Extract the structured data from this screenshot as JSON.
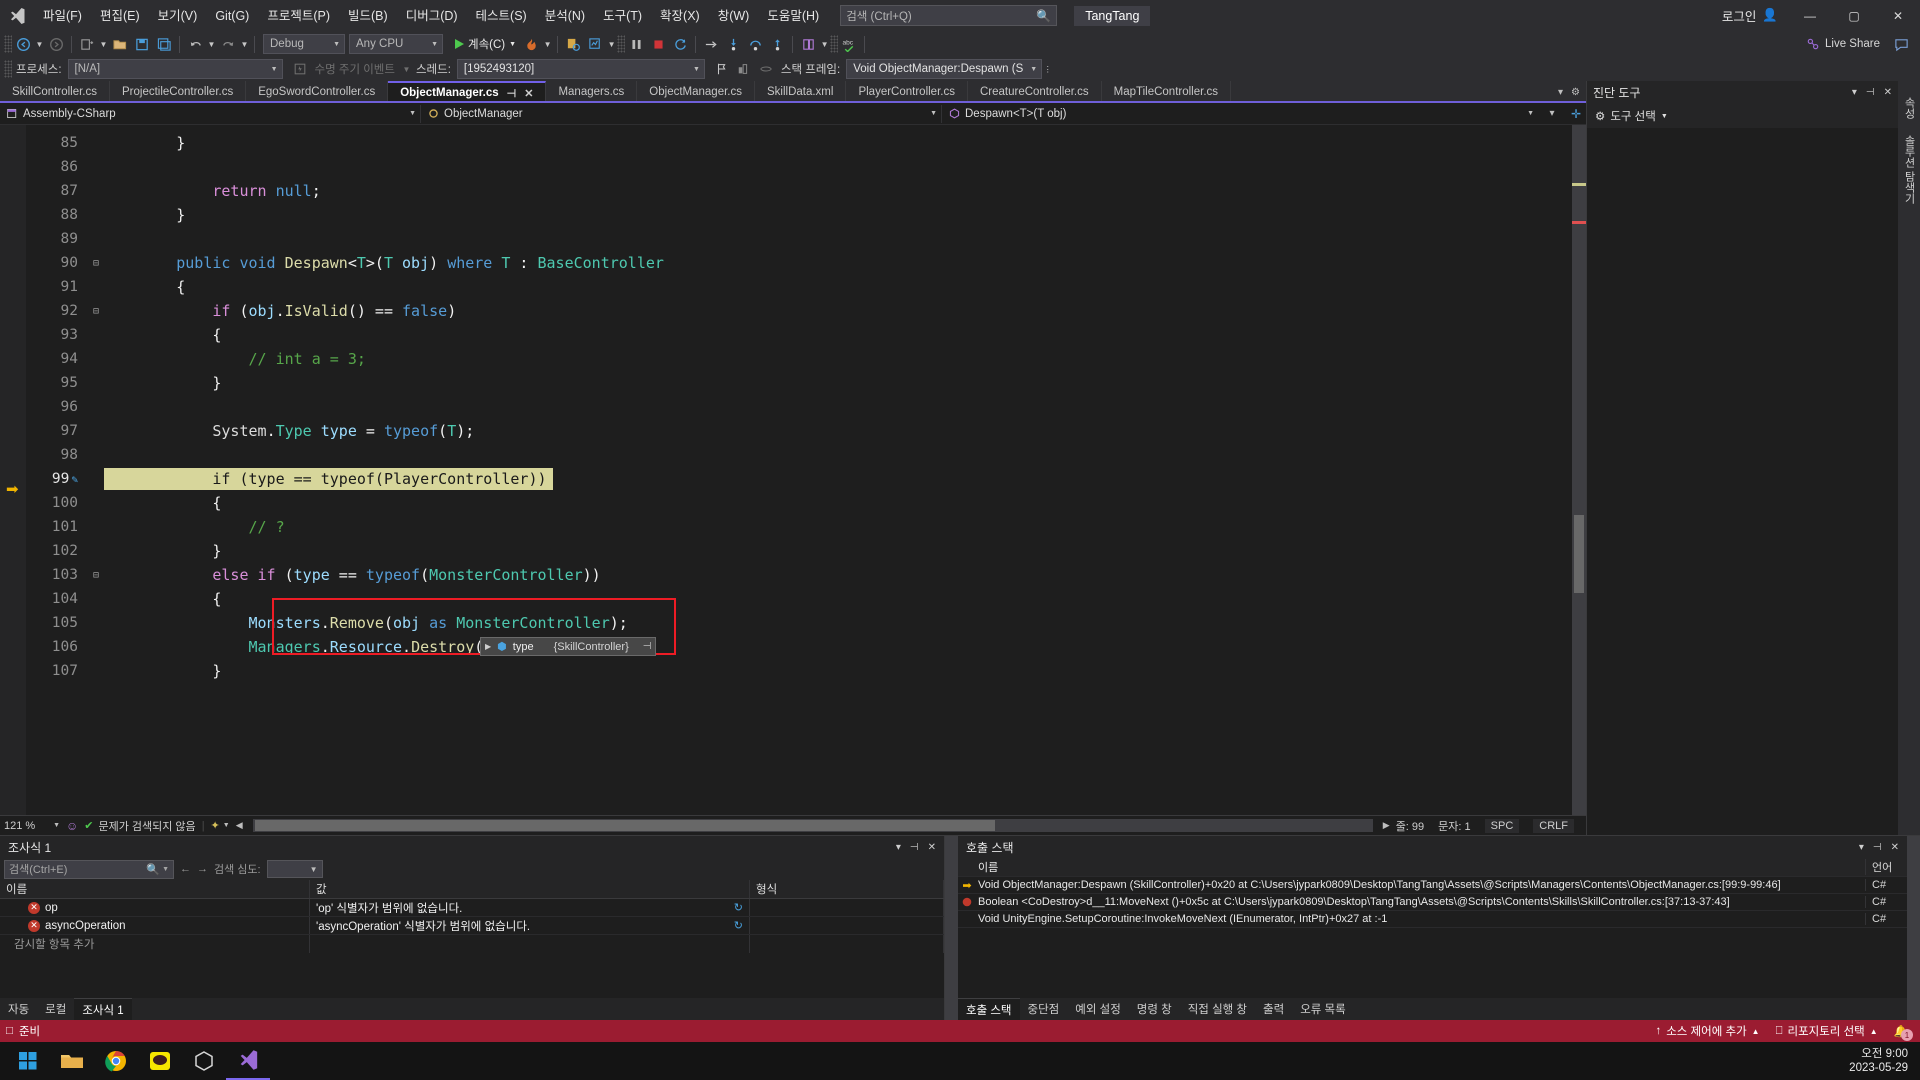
{
  "titlebar": {
    "menu_items": [
      "파일(F)",
      "편집(E)",
      "보기(V)",
      "Git(G)",
      "프로젝트(P)",
      "빌드(B)",
      "디버그(D)",
      "테스트(S)",
      "분석(N)",
      "도구(T)",
      "확장(X)",
      "창(W)",
      "도움말(H)"
    ],
    "search_placeholder": "검색 (Ctrl+Q)",
    "project_name": "TangTang",
    "signin_label": "로그인",
    "minimize": "—",
    "maximize": "▢",
    "close": "✕"
  },
  "toolbar": {
    "config": "Debug",
    "platform": "Any CPU",
    "run_label": "계속(C)",
    "live_share": "Live Share"
  },
  "debugbar": {
    "process_label": "프로세스:",
    "process_value": "[N/A]",
    "lifecycle_label": "수명 주기 이벤트",
    "thread_label": "스레드:",
    "thread_value": "[1952493120]",
    "stackframe_label": "스택 프레임:",
    "stackframe_value": "Void ObjectManager:Despawn (SkillCont"
  },
  "tabs": [
    {
      "label": "SkillController.cs",
      "active": false
    },
    {
      "label": "ProjectileController.cs",
      "active": false
    },
    {
      "label": "EgoSwordController.cs",
      "active": false
    },
    {
      "label": "ObjectManager.cs",
      "active": true
    },
    {
      "label": "Managers.cs",
      "active": false
    },
    {
      "label": "ObjectManager.cs",
      "active": false
    },
    {
      "label": "SkillData.xml",
      "active": false
    },
    {
      "label": "PlayerController.cs",
      "active": false
    },
    {
      "label": "CreatureController.cs",
      "active": false
    },
    {
      "label": "MapTileController.cs",
      "active": false
    }
  ],
  "navbar": {
    "project": "Assembly-CSharp",
    "class": "ObjectManager",
    "member": "Despawn<T>(T obj)"
  },
  "editor": {
    "first_line": 85,
    "current_line": 99,
    "lines": [
      {
        "n": 85,
        "html": "        }"
      },
      {
        "n": 86,
        "html": ""
      },
      {
        "n": 87,
        "html": "            <span class='kwc'>return</span> <span class='kw'>null</span>;"
      },
      {
        "n": 88,
        "html": "        }"
      },
      {
        "n": 89,
        "html": ""
      },
      {
        "n": 90,
        "html": "        <span class='kw'>public</span> <span class='kw'>void</span> <span class='fn'>Despawn</span>&lt;<span class='type'>T</span>&gt;(<span class='type'>T</span> <span class='var'>obj</span>) <span class='kw'>where</span> <span class='type'>T</span> : <span class='type'>BaseController</span>",
        "fold": true
      },
      {
        "n": 91,
        "html": "        {"
      },
      {
        "n": 92,
        "html": "            <span class='kwc'>if</span> (<span class='var'>obj</span>.<span class='fn'>IsValid</span>() == <span class='kw'>false</span>)",
        "fold": true
      },
      {
        "n": 93,
        "html": "            {"
      },
      {
        "n": 94,
        "html": "                <span class='cmt'>// int a = 3;</span>"
      },
      {
        "n": 95,
        "html": "            }"
      },
      {
        "n": 96,
        "html": ""
      },
      {
        "n": 97,
        "html": "            <span class='pln'>System</span>.<span class='type'>Type</span> <span class='var'>type</span> = <span class='kw'>typeof</span>(<span class='type'>T</span>);"
      },
      {
        "n": 98,
        "html": ""
      },
      {
        "n": 99,
        "html": "            if (type == typeof(PlayerController))",
        "current": true
      },
      {
        "n": 100,
        "html": "            {"
      },
      {
        "n": 101,
        "html": "                <span class='cmt'>// ?</span>"
      },
      {
        "n": 102,
        "html": "            }"
      },
      {
        "n": 103,
        "html": "            <span class='kwc'>else</span> <span class='kwc'>if</span> (<span class='var'>type</span> == <span class='kw'>typeof</span>(<span class='type'>MonsterController</span>))",
        "fold": true
      },
      {
        "n": 104,
        "html": "            {"
      },
      {
        "n": 105,
        "html": "                <span class='var'>Monsters</span>.<span class='fn'>Remove</span>(<span class='var'>obj</span> <span class='kw'>as</span> <span class='type'>MonsterController</span>);"
      },
      {
        "n": 106,
        "html": "                <span class='type'>Managers</span>.<span class='var'>Resource</span>.<span class='fn'>Destroy</span>(<span class='var'>obj</span>.<span class='var'>gameObject</span>);"
      },
      {
        "n": 107,
        "html": "            }"
      }
    ],
    "datatip": {
      "name": "type",
      "value": "{SkillController}"
    },
    "status": {
      "zoom": "121 %",
      "problems": "문제가 검색되지 않음",
      "line_label": "줄: 99",
      "col_label": "문자: 1",
      "spaces": "SPC",
      "eol": "CRLF"
    }
  },
  "diagnostics_panel": {
    "title": "진단 도구",
    "select_tools": "도구 선택",
    "vertical_tabs": [
      "속성",
      "솔루션 탐색기"
    ]
  },
  "watch_panel": {
    "title": "조사식 1",
    "search_placeholder": "검색(Ctrl+E)",
    "depth_label": "검색 심도:",
    "columns": [
      "이름",
      "값",
      "형식"
    ],
    "rows": [
      {
        "name": "op",
        "value": "'op' 식별자가 범위에 없습니다.",
        "type": ""
      },
      {
        "name": "asyncOperation",
        "value": "'asyncOperation' 식별자가 범위에 없습니다.",
        "type": ""
      }
    ],
    "add_row": "감시할 항목 추가",
    "tabs": [
      "자동",
      "로컬",
      "조사식 1"
    ],
    "active_tab": "조사식 1"
  },
  "callstack_panel": {
    "title": "호출 스택",
    "columns": [
      "이름",
      "언어"
    ],
    "rows": [
      {
        "marker": "current",
        "name": "Void ObjectManager:Despawn (SkillController)+0x20 at C:\\Users\\jypark0809\\Desktop\\TangTang\\Assets\\@Scripts\\Managers\\Contents\\ObjectManager.cs:[99:9-99:46]",
        "lang": "C#"
      },
      {
        "marker": "breakpoint",
        "name": "Boolean <CoDestroy>d__11:MoveNext ()+0x5c at C:\\Users\\jypark0809\\Desktop\\TangTang\\Assets\\@Scripts\\Contents\\Skills\\SkillController.cs:[37:13-37:43]",
        "lang": "C#"
      },
      {
        "marker": "none",
        "name": "Void UnityEngine.SetupCoroutine:InvokeMoveNext (IEnumerator, IntPtr)+0x27 at :-1",
        "lang": "C#"
      }
    ],
    "tabs": [
      "호출 스택",
      "중단점",
      "예외 설정",
      "명령 창",
      "직접 실행 창",
      "출력",
      "오류 목록"
    ],
    "active_tab": "호출 스택"
  },
  "statusbar": {
    "state": "준비",
    "add_source_control": "소스 제어에 추가",
    "select_repo": "리포지토리 선택",
    "notification_count": "1"
  },
  "taskbar": {
    "time": "오전 9:00",
    "date": "2023-05-29"
  },
  "colors": {
    "accent_purple": "#7160e8",
    "status_red": "#9b1c31",
    "highlight_yellow": "#d7d69b",
    "box_red": "#ee1c25"
  }
}
